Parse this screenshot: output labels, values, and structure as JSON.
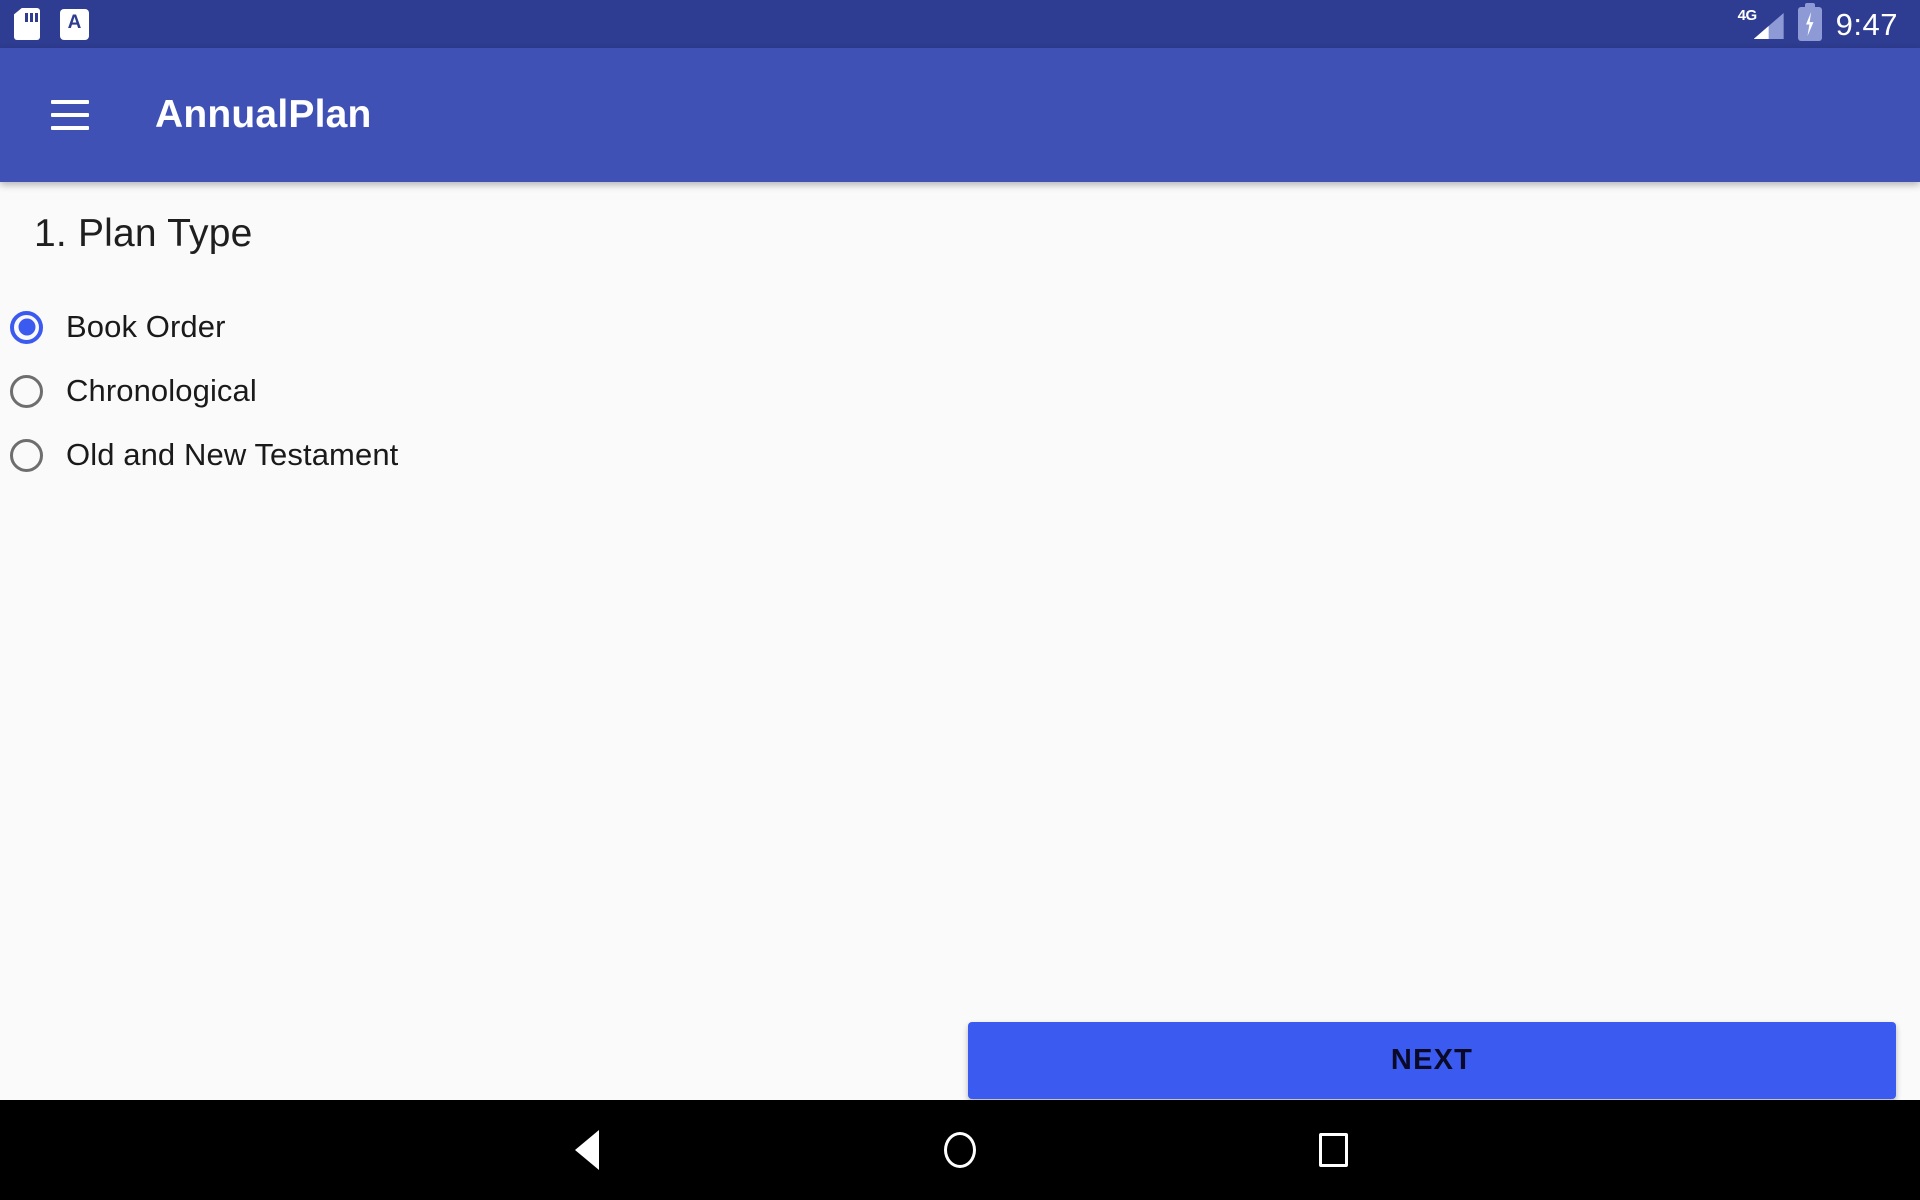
{
  "status_bar": {
    "left_icons": [
      {
        "name": "sd-card-icon",
        "label": "SD card"
      },
      {
        "name": "input-method-icon",
        "label": "A"
      }
    ],
    "network_label": "4G",
    "battery_state": "charging",
    "time": "9:47",
    "background_color": "#2E3C91"
  },
  "app_bar": {
    "menu_icon": "hamburger-menu-icon",
    "title": "AnnualPlan",
    "background_color": "#3F51B5"
  },
  "main": {
    "section_title": "1. Plan Type",
    "radio_group": {
      "selected_index": 0,
      "options": [
        {
          "label": "Book Order",
          "selected": true
        },
        {
          "label": "Chronological",
          "selected": false
        },
        {
          "label": "Old and New Testament",
          "selected": false
        }
      ]
    },
    "next_button": {
      "label": "NEXT",
      "color": "#3B5AF0",
      "text_color": "#0A0A28"
    },
    "background_color": "#FAFAFA",
    "accent_color": "#3B5AF0"
  },
  "nav_bar": {
    "buttons": [
      {
        "name": "back-button",
        "icon": "triangle-left-icon"
      },
      {
        "name": "home-button",
        "icon": "circle-icon"
      },
      {
        "name": "recents-button",
        "icon": "square-icon"
      }
    ],
    "background_color": "#000000"
  }
}
